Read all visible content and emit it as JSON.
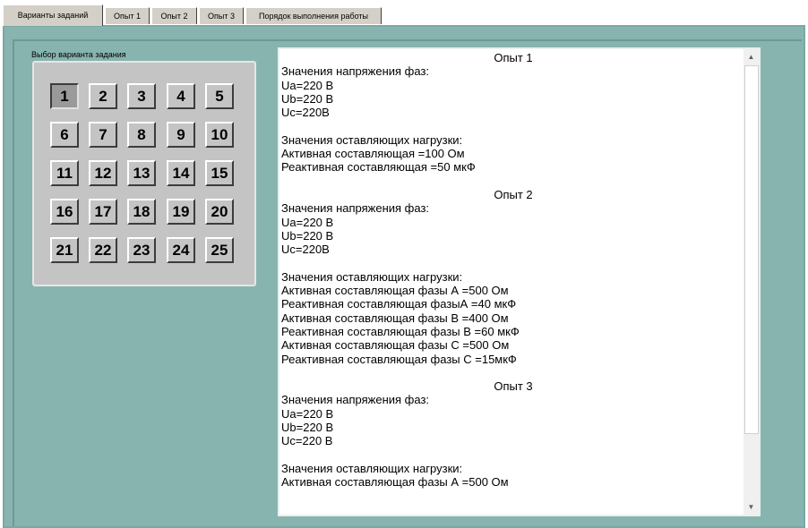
{
  "tabs": [
    {
      "label": "Варианты заданий",
      "active": true
    },
    {
      "label": "Опыт 1",
      "active": false
    },
    {
      "label": "Опыт 2",
      "active": false
    },
    {
      "label": "Опыт 3",
      "active": false
    },
    {
      "label": "Порядок выполнения работы",
      "active": false
    }
  ],
  "variant_group": {
    "label": "Выбор варианта задания",
    "selected": "1",
    "buttons": [
      "1",
      "2",
      "3",
      "4",
      "5",
      "6",
      "7",
      "8",
      "9",
      "10",
      "11",
      "12",
      "13",
      "14",
      "15",
      "16",
      "17",
      "18",
      "19",
      "20",
      "21",
      "22",
      "23",
      "24",
      "25"
    ]
  },
  "text_panel": {
    "lines": [
      {
        "text": "Опыт 1",
        "heading": true
      },
      {
        "text": "Значения напряжения фаз:"
      },
      {
        "text": "Ua=220 В"
      },
      {
        "text": "Ub=220 В"
      },
      {
        "text": "Uc=220В"
      },
      {
        "text": ""
      },
      {
        "text": "Значения оставляющих нагрузки:"
      },
      {
        "text": "Активная составляющая =100 Ом"
      },
      {
        "text": "Реактивная составляющая =50 мкФ"
      },
      {
        "text": ""
      },
      {
        "text": "Опыт 2",
        "heading": true
      },
      {
        "text": "Значения напряжения фаз:"
      },
      {
        "text": "Ua=220 В"
      },
      {
        "text": "Ub=220 В"
      },
      {
        "text": "Uc=220В"
      },
      {
        "text": ""
      },
      {
        "text": "Значения оставляющих нагрузки:"
      },
      {
        "text": "Активная составляющая фазы А =500 Ом"
      },
      {
        "text": "Реактивная составляющая фазыА =40 мкФ"
      },
      {
        "text": "Активная составляющая фазы В =400 Ом"
      },
      {
        "text": "Реактивная составляющая фазы В =60 мкФ"
      },
      {
        "text": "Активная составляющая фазы С =500 Ом"
      },
      {
        "text": "Реактивная составляющая фазы С =15мкФ"
      },
      {
        "text": ""
      },
      {
        "text": "Опыт 3",
        "heading": true
      },
      {
        "text": "Значения напряжения фаз:"
      },
      {
        "text": "Ua=220 В"
      },
      {
        "text": "Ub=220 В"
      },
      {
        "text": "Uc=220 В"
      },
      {
        "text": ""
      },
      {
        "text": "Значения оставляющих нагрузки:"
      },
      {
        "text": "Активная составляющая фазы А =500 Ом"
      }
    ]
  },
  "icons": {
    "scroll_up": "up-arrow-icon",
    "scroll_down": "down-arrow-icon"
  },
  "colors": {
    "panel_bg": "#88b4b0",
    "button_face": "#c4c4c4",
    "tab_face": "#d4d0c8"
  }
}
